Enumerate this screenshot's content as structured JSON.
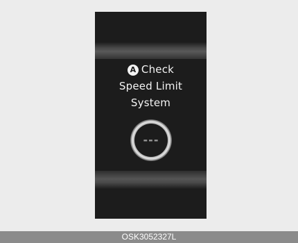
{
  "display": {
    "marker": "A",
    "line1": "Check",
    "line2": "Speed Limit",
    "line3": "System",
    "gauge_readout": "---",
    "gauge_icon": "speed-limit-circle-icon"
  },
  "caption": {
    "code": "OSK3052327L"
  },
  "colors": {
    "screen": "#1c1c1c",
    "text": "#f4f4f4",
    "caption_bar": "#8b8b8b"
  }
}
